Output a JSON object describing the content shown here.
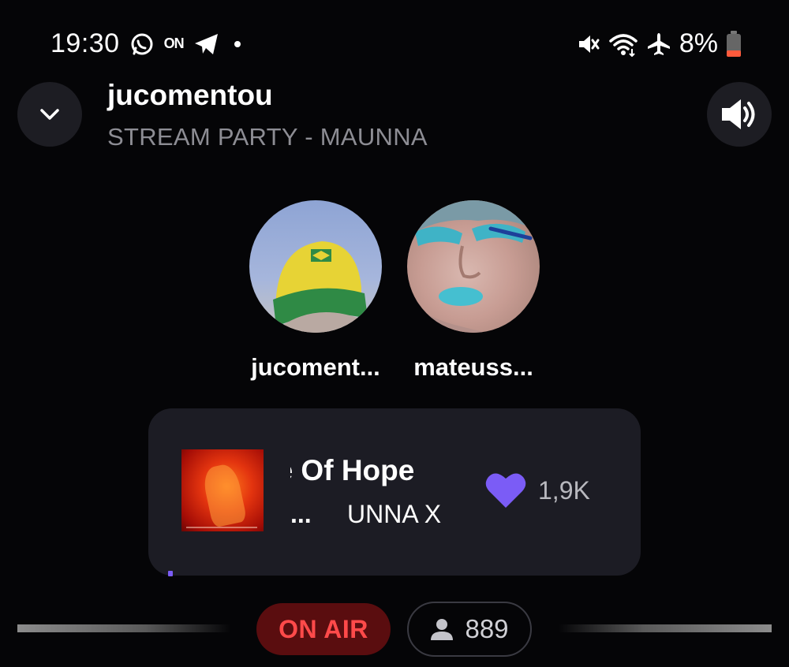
{
  "status_bar": {
    "time": "19:30",
    "on_badge": "ON",
    "battery_percent": "8%",
    "icons_left": [
      "whatsapp-icon",
      "on-badge",
      "telegram-icon",
      "notification-dot"
    ],
    "icons_right": [
      "mute-icon",
      "wifi-icon",
      "airplane-icon",
      "battery-low-icon"
    ],
    "battery_color": "#ff5a3c"
  },
  "header": {
    "title": "jucomentou",
    "subtitle": "STREAM PARTY - MAUNNA"
  },
  "participants": [
    {
      "name": "jucoment...",
      "avatar": "yellow-green-cap-photo"
    },
    {
      "name": "mateuss...",
      "avatar": "blue-makeup-face-photo"
    }
  ],
  "now_playing": {
    "title": "se Of Hope",
    "artist_prefix": "...",
    "artist": "UNNA X",
    "likes": "1,9K",
    "progress": 0.0,
    "accent_color": "#7b5cf6"
  },
  "footer": {
    "on_air_label": "ON AIR",
    "listeners_count": "889"
  },
  "colors": {
    "background": "#050507",
    "card": "#1c1c24",
    "on_air_bg": "#5a0d0f",
    "on_air_text": "#ff4a4a",
    "heart": "#7b5cf6"
  }
}
